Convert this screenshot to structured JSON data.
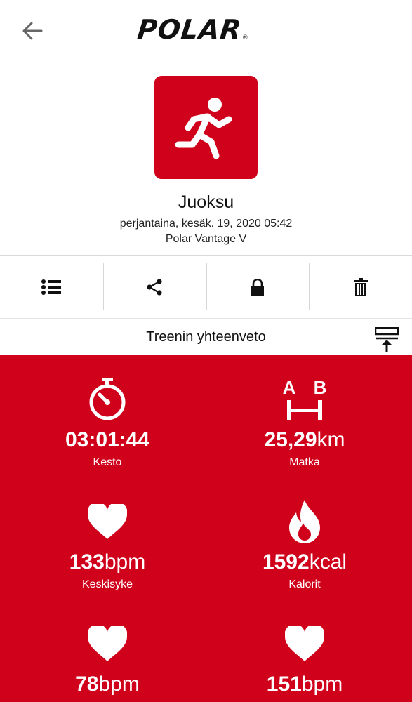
{
  "header": {
    "back_icon": "arrow-left-icon",
    "logo_text": "POLAR",
    "logo_mark": "®"
  },
  "activity": {
    "sport_icon": "running-person-icon",
    "name": "Juoksu",
    "datetime": "perjantaina, kesäk. 19, 2020 05:42",
    "device": "Polar Vantage V"
  },
  "actions": [
    {
      "icon": "list-icon"
    },
    {
      "icon": "share-icon"
    },
    {
      "icon": "lock-icon"
    },
    {
      "icon": "trash-icon"
    }
  ],
  "summary": {
    "title": "Treenin yhteenveto",
    "pin_icon": "pin-to-top-icon"
  },
  "stats": [
    {
      "icon": "stopwatch-icon",
      "value": "03:01:44",
      "unit": "",
      "label": "Kesto"
    },
    {
      "icon": "distance-ab-icon",
      "value": "25,29",
      "unit": "km",
      "label": "Matka"
    },
    {
      "icon": "heart-icon",
      "value": "133",
      "unit": "bpm",
      "label": "Keskisyke"
    },
    {
      "icon": "flame-icon",
      "value": "1592",
      "unit": "kcal",
      "label": "Kalorit"
    },
    {
      "icon": "heart-icon",
      "value": "78",
      "unit": "bpm",
      "label": ""
    },
    {
      "icon": "heart-icon",
      "value": "151",
      "unit": "bpm",
      "label": ""
    }
  ],
  "colors": {
    "brand_red": "#d0021b",
    "text": "#111111"
  }
}
